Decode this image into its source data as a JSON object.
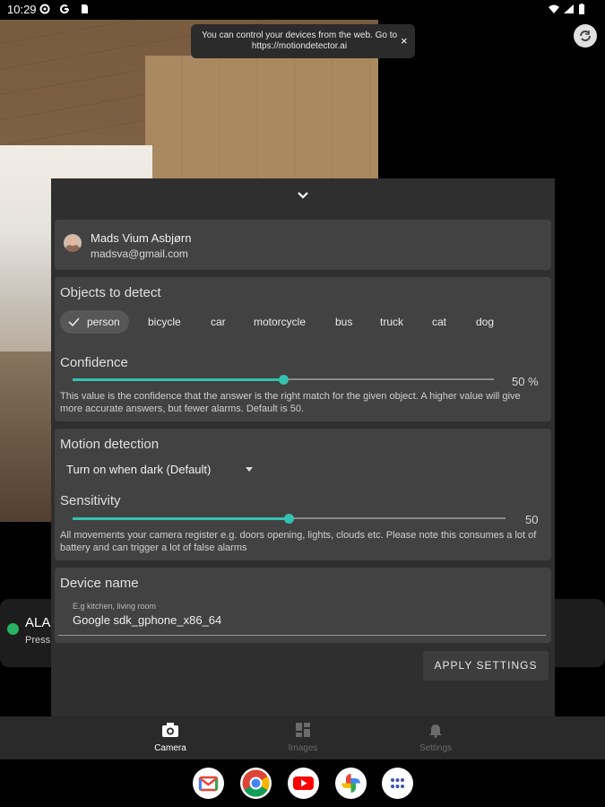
{
  "status_bar": {
    "time": "10:29"
  },
  "toast": {
    "message": "You can control your devices from the web. Go to https://motiondetector.ai",
    "close": "×"
  },
  "alarm_card": {
    "title": "ALA",
    "subtitle": "Press"
  },
  "user": {
    "name": "Mads Vium Asbjørn",
    "email": "madsva@gmail.com"
  },
  "objects": {
    "title": "Objects to detect",
    "chips": [
      {
        "label": "person",
        "selected": true
      },
      {
        "label": "bicycle",
        "selected": false
      },
      {
        "label": "car",
        "selected": false
      },
      {
        "label": "motorcycle",
        "selected": false
      },
      {
        "label": "bus",
        "selected": false
      },
      {
        "label": "truck",
        "selected": false
      },
      {
        "label": "cat",
        "selected": false
      },
      {
        "label": "dog",
        "selected": false
      }
    ],
    "confidence": {
      "title": "Confidence",
      "value": 50,
      "value_text": "50 %",
      "help": "This value is the confidence that the answer is the right match for the given object. A higher value will give more accurate answers, but fewer alarms. Default is 50."
    }
  },
  "motion": {
    "title": "Motion detection",
    "mode": "Turn on when dark (Default)",
    "sensitivity": {
      "title": "Sensitivity",
      "value": 50,
      "value_text": "50",
      "help": "All movements your camera register e.g. doors opening, lights, clouds etc. Please note this consumes a lot of battery and can trigger a lot of false alarms"
    }
  },
  "device": {
    "title": "Device name",
    "hint": "E.g kitchen, living room",
    "value": "Google sdk_gphone_x86_64"
  },
  "apply_label": "APPLY SETTINGS",
  "nav": {
    "items": [
      {
        "label": "Camera",
        "icon": "camera-icon",
        "active": true
      },
      {
        "label": "Images",
        "icon": "images-icon",
        "active": false
      },
      {
        "label": "Settings",
        "icon": "bell-icon",
        "active": false
      }
    ]
  },
  "colors": {
    "accent": "#35c2b0",
    "sheet": "#2f2f2f",
    "card": "#424242",
    "alarm_dot": "#28b463"
  },
  "dock": [
    "gmail-icon",
    "chrome-icon",
    "youtube-icon",
    "photos-icon",
    "app-drawer-icon"
  ]
}
